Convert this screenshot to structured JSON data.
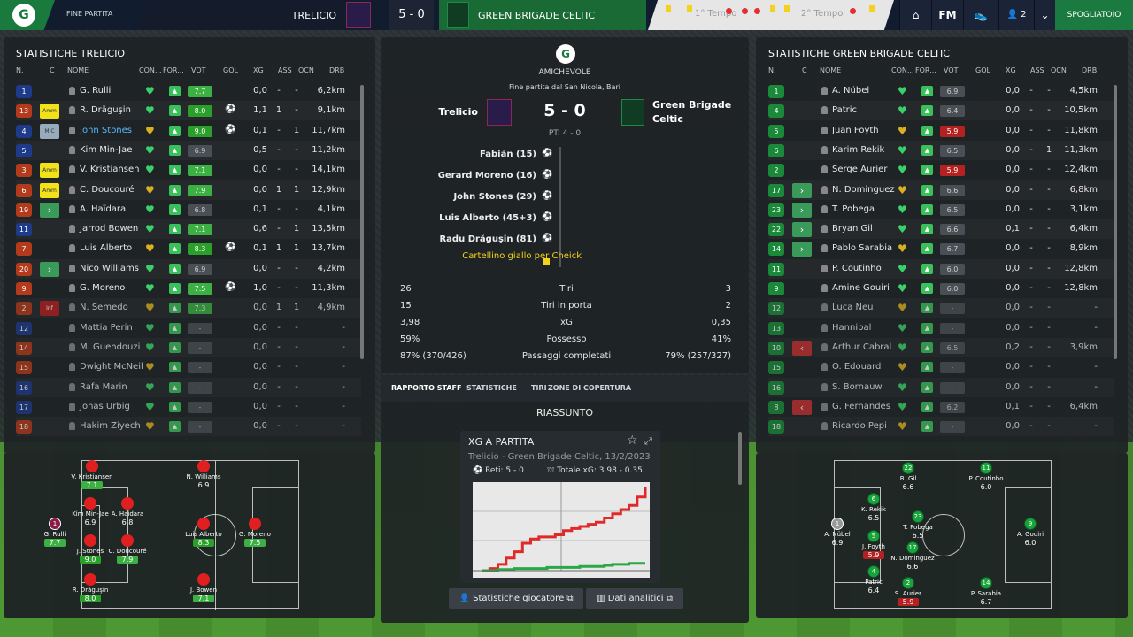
{
  "topbar": {
    "phase": "FINE PARTITA",
    "home_team": "TRELICIO",
    "score": "5 - 0",
    "away_team": "GREEN BRIGADE CELTIC",
    "half1": "1° Tempo",
    "half2": "2° Tempo",
    "fm_label": "FM",
    "profile_count": "2",
    "continue_label": "SPOGLIATOIO"
  },
  "home_panel": {
    "title": "STATISTICHE TRELICIO",
    "headers": [
      "N.",
      "C",
      "NOME",
      "CON...",
      "FOR...",
      "VOT",
      "GOL",
      "XG",
      "ASS",
      "OCN",
      "DRB"
    ],
    "players": [
      {
        "n": "1",
        "c": "",
        "name": "G. Rulli",
        "vote": "7.7",
        "goal": "",
        "xg": "0,0",
        "ass": "-",
        "ocn": "-",
        "drb": "6,2km",
        "vc": "#3cb043",
        "nc": "#1e3a8a"
      },
      {
        "n": "13",
        "c": "Amm",
        "name": "R. Drăguşin",
        "vote": "8.0",
        "goal": "⚽",
        "xg": "1,1",
        "ass": "1",
        "ocn": "-",
        "drb": "9,1km",
        "vc": "#2aa02a",
        "nc": "#b33a1a"
      },
      {
        "n": "4",
        "c": "MIC",
        "name": "John Stones",
        "vote": "9.0",
        "goal": "⚽",
        "xg": "0,1",
        "ass": "-",
        "ocn": "1",
        "drb": "11,7km",
        "vc": "#2aa02a",
        "nc": "#1e3a8a",
        "hl": "1"
      },
      {
        "n": "5",
        "c": "",
        "name": "Kim Min-Jae",
        "vote": "6.9",
        "goal": "",
        "xg": "0,5",
        "ass": "-",
        "ocn": "-",
        "drb": "11,2km",
        "vc": "#4a4f55",
        "nc": "#1e3a8a"
      },
      {
        "n": "3",
        "c": "Amm",
        "name": "V. Kristiansen",
        "vote": "7.1",
        "goal": "",
        "xg": "0,0",
        "ass": "-",
        "ocn": "-",
        "drb": "14,1km",
        "vc": "#3cb043",
        "nc": "#b33a1a"
      },
      {
        "n": "6",
        "c": "Amm",
        "name": "C. Doucouré",
        "vote": "7.9",
        "goal": "",
        "xg": "0,0",
        "ass": "1",
        "ocn": "1",
        "drb": "12,9km",
        "vc": "#3cb043",
        "nc": "#b33a1a"
      },
      {
        "n": "19",
        "c": "sub",
        "name": "A. Haïdara",
        "vote": "6.8",
        "goal": "",
        "xg": "0,1",
        "ass": "-",
        "ocn": "-",
        "drb": "4,1km",
        "vc": "#4a4f55",
        "nc": "#b33a1a"
      },
      {
        "n": "11",
        "c": "",
        "name": "Jarrod Bowen",
        "vote": "7.1",
        "goal": "",
        "xg": "0,6",
        "ass": "-",
        "ocn": "1",
        "drb": "13,5km",
        "vc": "#3cb043",
        "nc": "#1e3a8a"
      },
      {
        "n": "7",
        "c": "",
        "name": "Luis Alberto",
        "vote": "8.3",
        "goal": "⚽",
        "xg": "0,1",
        "ass": "1",
        "ocn": "1",
        "drb": "13,7km",
        "vc": "#2aa02a",
        "nc": "#b33a1a"
      },
      {
        "n": "20",
        "c": "sub",
        "name": "Nico Williams",
        "vote": "6.9",
        "goal": "",
        "xg": "0,0",
        "ass": "-",
        "ocn": "-",
        "drb": "4,2km",
        "vc": "#4a4f55",
        "nc": "#b33a1a"
      },
      {
        "n": "9",
        "c": "",
        "name": "G. Moreno",
        "vote": "7.5",
        "goal": "⚽",
        "xg": "1,0",
        "ass": "-",
        "ocn": "-",
        "drb": "11,3km",
        "vc": "#3cb043",
        "nc": "#b33a1a"
      },
      {
        "n": "2",
        "c": "Inf",
        "name": "N. Semedo",
        "vote": "7.3",
        "goal": "",
        "xg": "0,0",
        "ass": "1",
        "ocn": "1",
        "drb": "4,9km",
        "vc": "#3cb043",
        "nc": "#b33a1a",
        "dim": "1"
      },
      {
        "n": "12",
        "c": "",
        "name": "Mattia Perin",
        "vote": "-",
        "goal": "",
        "xg": "0,0",
        "ass": "-",
        "ocn": "-",
        "drb": "-",
        "vc": "#4a4f55",
        "nc": "#1e3a8a",
        "dim": "1"
      },
      {
        "n": "14",
        "c": "",
        "name": "M. Guendouzi",
        "vote": "-",
        "goal": "",
        "xg": "0,0",
        "ass": "-",
        "ocn": "-",
        "drb": "-",
        "vc": "#4a4f55",
        "nc": "#b33a1a",
        "dim": "1"
      },
      {
        "n": "15",
        "c": "",
        "name": "Dwight McNeil",
        "vote": "-",
        "goal": "",
        "xg": "0,0",
        "ass": "-",
        "ocn": "-",
        "drb": "-",
        "vc": "#4a4f55",
        "nc": "#b33a1a",
        "dim": "1"
      },
      {
        "n": "16",
        "c": "",
        "name": "Rafa Marin",
        "vote": "-",
        "goal": "",
        "xg": "0,0",
        "ass": "-",
        "ocn": "-",
        "drb": "-",
        "vc": "#4a4f55",
        "nc": "#1e3a8a",
        "dim": "1"
      },
      {
        "n": "17",
        "c": "",
        "name": "Jonas Urbig",
        "vote": "-",
        "goal": "",
        "xg": "0,0",
        "ass": "-",
        "ocn": "-",
        "drb": "-",
        "vc": "#4a4f55",
        "nc": "#1e3a8a",
        "dim": "1"
      },
      {
        "n": "18",
        "c": "",
        "name": "Hakim Ziyech",
        "vote": "-",
        "goal": "",
        "xg": "0,0",
        "ass": "-",
        "ocn": "-",
        "drb": "-",
        "vc": "#4a4f55",
        "nc": "#b33a1a",
        "dim": "1"
      }
    ]
  },
  "home_pitch": [
    {
      "name": "G. Rulli",
      "r": "7.7",
      "rc": "#3cb043",
      "gk": "1",
      "num": "1"
    },
    {
      "name": "V. Kristiansen",
      "r": "7.1",
      "rc": "#3cb043"
    },
    {
      "name": "Kim Min-Jae",
      "r": "6.9",
      "rc": ""
    },
    {
      "name": "J. Stones",
      "r": "9.0",
      "rc": "#2aa02a"
    },
    {
      "name": "R. Drăguşin",
      "r": "8.0",
      "rc": "#2aa02a"
    },
    {
      "name": "A. Haidara",
      "r": "6.8",
      "rc": ""
    },
    {
      "name": "C. Doucouré",
      "r": "7.9",
      "rc": "#3cb043"
    },
    {
      "name": "N. Williams",
      "r": "6.9",
      "rc": ""
    },
    {
      "name": "Luis Alberto",
      "r": "8.3",
      "rc": "#2aa02a"
    },
    {
      "name": "J. Bowen",
      "r": "7.1",
      "rc": "#3cb043"
    },
    {
      "name": "G. Moreno",
      "r": "7.5",
      "rc": "#3cb043"
    }
  ],
  "match": {
    "competition": "AMICHEVOLE",
    "subtitle": "Fine partita dal San Nicola, Bari",
    "home": "Trelicio",
    "score": "5 - 0",
    "away": "Green Brigade Celtic",
    "ht": "PT: 4 - 0",
    "events": [
      "Fabián (15)",
      "Gerard Moreno (16)",
      "John Stones (29)",
      "Luis Alberto (45+3)",
      "Radu Drăguşin (81)"
    ],
    "card_event": "Cartellino giallo per Cheick",
    "stats": [
      {
        "h": "26",
        "l": "Tiri",
        "a": "3"
      },
      {
        "h": "15",
        "l": "Tiri in porta",
        "a": "2"
      },
      {
        "h": "3,98",
        "l": "xG",
        "a": "0,35"
      },
      {
        "h": "59%",
        "l": "Possesso",
        "a": "41%"
      },
      {
        "h": "87% (370/426)",
        "l": "Passaggi completati",
        "a": "79% (257/327)"
      }
    ],
    "tabs": [
      "RAPPORTO STAFF",
      "STATISTICHE",
      "TIRI",
      "ZONE DI COPERTURA"
    ],
    "summary": "RIASSUNTO",
    "xg_card": {
      "title": "XG A PARTITA",
      "sub": "Trelicio - Green Brigade Celtic, 13/2/2023",
      "goals": "Reti: 5 - 0",
      "total": "Totale xG: 3.98 - 0.35"
    },
    "btn1": "Statistiche giocatore",
    "btn2": "Dati analitici"
  },
  "chart_data": {
    "type": "line",
    "title": "XG A PARTITA",
    "series": [
      {
        "name": "Trelicio",
        "color": "#e02a2a",
        "values": [
          0,
          0.1,
          0.3,
          0.6,
          0.9,
          1.3,
          1.5,
          1.6,
          1.6,
          1.7,
          1.9,
          2.0,
          2.1,
          2.2,
          2.3,
          2.5,
          2.7,
          2.9,
          3.1,
          3.5,
          3.98
        ]
      },
      {
        "name": "Green Brigade Celtic",
        "color": "#2aa845",
        "values": [
          0,
          0,
          0.05,
          0.05,
          0.1,
          0.1,
          0.1,
          0.1,
          0.15,
          0.15,
          0.15,
          0.15,
          0.2,
          0.2,
          0.2,
          0.25,
          0.3,
          0.3,
          0.35,
          0.35,
          0.35
        ]
      }
    ],
    "ylim": [
      0,
      4.2
    ]
  },
  "away_panel": {
    "title": "STATISTICHE GREEN BRIGADE CELTIC",
    "headers": [
      "N.",
      "C",
      "NOME",
      "CON...",
      "FOR...",
      "VOT",
      "GOL",
      "XG",
      "ASS",
      "OCN",
      "DRB"
    ],
    "players": [
      {
        "n": "1",
        "c": "",
        "name": "A. Nübel",
        "vote": "6.9",
        "xg": "0,0",
        "ass": "-",
        "ocn": "-",
        "drb": "4,5km",
        "vc": "#4a4f55"
      },
      {
        "n": "4",
        "c": "",
        "name": "Patric",
        "vote": "6.4",
        "xg": "0,0",
        "ass": "-",
        "ocn": "-",
        "drb": "10,5km",
        "vc": "#4a4f55"
      },
      {
        "n": "5",
        "c": "",
        "name": "Juan Foyth",
        "vote": "5.9",
        "xg": "0,0",
        "ass": "-",
        "ocn": "-",
        "drb": "11,8km",
        "vc": "#b52020"
      },
      {
        "n": "6",
        "c": "",
        "name": "Karim Rekik",
        "vote": "6.5",
        "xg": "0,0",
        "ass": "-",
        "ocn": "1",
        "drb": "11,3km",
        "vc": "#4a4f55"
      },
      {
        "n": "2",
        "c": "",
        "name": "Serge Aurier",
        "vote": "5.9",
        "xg": "0,0",
        "ass": "-",
        "ocn": "-",
        "drb": "12,4km",
        "vc": "#b52020"
      },
      {
        "n": "17",
        "c": "sub",
        "name": "N. Dominguez",
        "vote": "6.6",
        "xg": "0,0",
        "ass": "-",
        "ocn": "-",
        "drb": "6,8km",
        "vc": "#4a4f55"
      },
      {
        "n": "23",
        "c": "sub",
        "name": "T. Pobega",
        "vote": "6.5",
        "xg": "0,0",
        "ass": "-",
        "ocn": "-",
        "drb": "3,1km",
        "vc": "#4a4f55"
      },
      {
        "n": "22",
        "c": "sub",
        "name": "Bryan Gil",
        "vote": "6.6",
        "xg": "0,1",
        "ass": "-",
        "ocn": "-",
        "drb": "6,4km",
        "vc": "#4a4f55"
      },
      {
        "n": "14",
        "c": "sub",
        "name": "Pablo Sarabia",
        "vote": "6.7",
        "xg": "0,0",
        "ass": "-",
        "ocn": "-",
        "drb": "8,9km",
        "vc": "#4a4f55"
      },
      {
        "n": "11",
        "c": "",
        "name": "P. Coutinho",
        "vote": "6.0",
        "xg": "0,0",
        "ass": "-",
        "ocn": "-",
        "drb": "12,8km",
        "vc": "#4a4f55"
      },
      {
        "n": "9",
        "c": "",
        "name": "Amine Gouiri",
        "vote": "6.0",
        "xg": "0,0",
        "ass": "-",
        "ocn": "-",
        "drb": "12,8km",
        "vc": "#4a4f55"
      },
      {
        "n": "12",
        "c": "",
        "name": "Luca Neu",
        "vote": "-",
        "xg": "0,0",
        "ass": "-",
        "ocn": "-",
        "drb": "-",
        "vc": "#4a4f55",
        "dim": "1"
      },
      {
        "n": "13",
        "c": "",
        "name": "Hannibal",
        "vote": "-",
        "xg": "0,0",
        "ass": "-",
        "ocn": "-",
        "drb": "-",
        "vc": "#4a4f55",
        "dim": "1"
      },
      {
        "n": "10",
        "c": "out",
        "name": "Arthur Cabral",
        "vote": "6.5",
        "xg": "0,2",
        "ass": "-",
        "ocn": "-",
        "drb": "3,9km",
        "vc": "#4a4f55",
        "dim": "1"
      },
      {
        "n": "15",
        "c": "",
        "name": "O. Edouard",
        "vote": "-",
        "xg": "0,0",
        "ass": "-",
        "ocn": "-",
        "drb": "-",
        "vc": "#4a4f55",
        "dim": "1"
      },
      {
        "n": "16",
        "c": "",
        "name": "S. Bornauw",
        "vote": "-",
        "xg": "0,0",
        "ass": "-",
        "ocn": "-",
        "drb": "-",
        "vc": "#4a4f55",
        "dim": "1"
      },
      {
        "n": "8",
        "c": "out",
        "name": "G. Fernandes",
        "vote": "6.2",
        "xg": "0,1",
        "ass": "-",
        "ocn": "-",
        "drb": "6,4km",
        "vc": "#4a4f55",
        "dim": "1"
      },
      {
        "n": "18",
        "c": "",
        "name": "Ricardo Pepi",
        "vote": "-",
        "xg": "0,0",
        "ass": "-",
        "ocn": "-",
        "drb": "-",
        "vc": "#4a4f55",
        "dim": "1"
      }
    ]
  },
  "away_pitch": [
    {
      "name": "A. Nübel",
      "r": "6.9",
      "num": "1",
      "gk": "1"
    },
    {
      "name": "K. Rekik",
      "r": "6.5",
      "num": "6"
    },
    {
      "name": "J. Foyth",
      "r": "5.9",
      "rc": "#b52020",
      "num": "5"
    },
    {
      "name": "Patric",
      "r": "6.4",
      "num": "4"
    },
    {
      "name": "B. Gil",
      "r": "6.6",
      "num": "22"
    },
    {
      "name": "T. Pobega",
      "r": "6.5",
      "num": "23"
    },
    {
      "name": "N. Dominguez",
      "r": "6.6",
      "num": "17"
    },
    {
      "name": "S. Aurier",
      "r": "5.9",
      "rc": "#b52020",
      "num": "2"
    },
    {
      "name": "P. Coutinho",
      "r": "6.0",
      "num": "11"
    },
    {
      "name": "P. Sarabia",
      "r": "6.7",
      "num": "14"
    },
    {
      "name": "A. Gouiri",
      "r": "6.0",
      "num": "9"
    }
  ]
}
